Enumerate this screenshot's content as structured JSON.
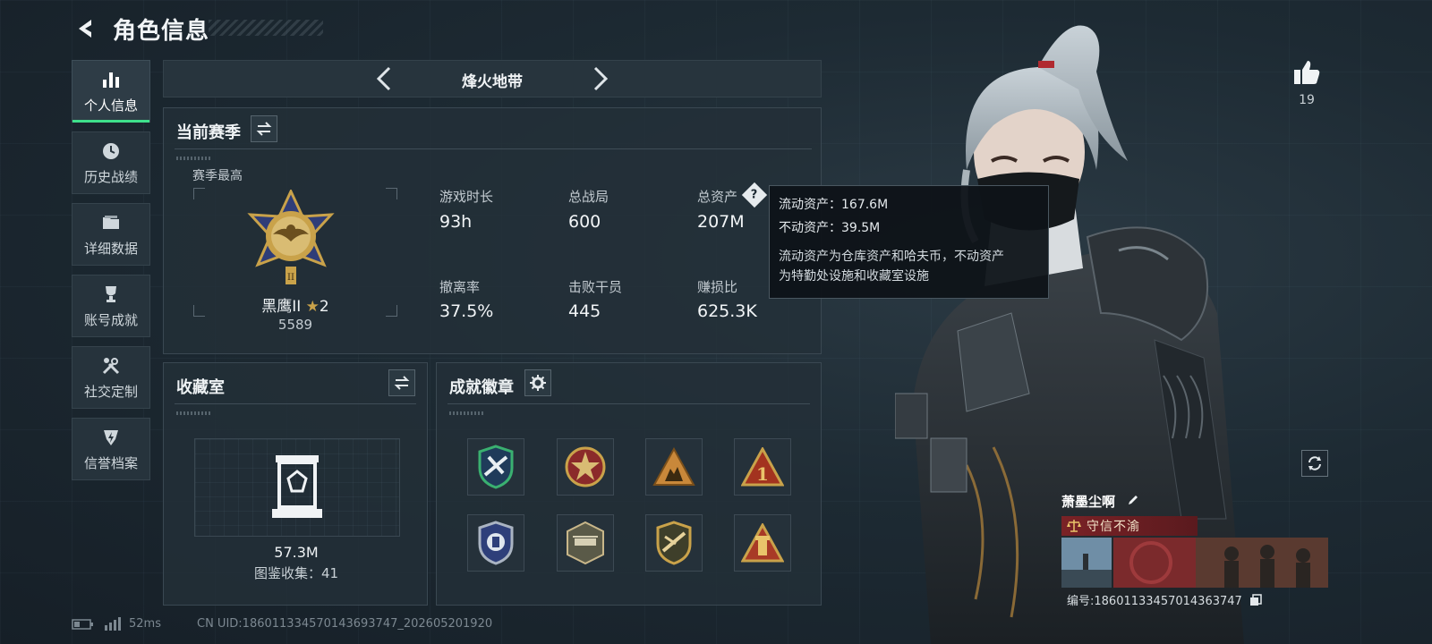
{
  "header": {
    "title": "角色信息"
  },
  "sidebar": {
    "items": [
      {
        "label": "个人信息",
        "icon": "bar-chart-icon",
        "active": true
      },
      {
        "label": "历史战绩",
        "icon": "clock-icon"
      },
      {
        "label": "详细数据",
        "icon": "folder-icon"
      },
      {
        "label": "账号成就",
        "icon": "trophy-icon"
      },
      {
        "label": "社交定制",
        "icon": "tools-icon"
      },
      {
        "label": "信誉档案",
        "icon": "shield-lightning-icon"
      }
    ]
  },
  "mode_selector": {
    "current": "烽火地带"
  },
  "season": {
    "title": "当前赛季",
    "best_label": "赛季最高",
    "rank_name": "黑鹰II",
    "rank_stars": "2",
    "rank_score": "5589",
    "stats": [
      {
        "label": "游戏时长",
        "value": "93h"
      },
      {
        "label": "总战局",
        "value": "600"
      },
      {
        "label": "总资产",
        "value": "207M"
      },
      {
        "label": "撤离率",
        "value": "37.5%"
      },
      {
        "label": "击败干员",
        "value": "445"
      },
      {
        "label": "赚损比",
        "value": "625.3K"
      }
    ]
  },
  "tooltip": {
    "liquid": "流动资产：167.6M",
    "fixed": "不动资产：39.5M",
    "description_line1": "流动资产为仓库资产和哈夫币，不动资产",
    "description_line2": "为特勤处设施和收藏室设施"
  },
  "collection": {
    "title": "收藏室",
    "value": "57.3M",
    "catalog": "图鉴收集：41"
  },
  "achievements": {
    "title": "成就徽章",
    "badges": [
      "badge-1",
      "badge-2",
      "badge-3",
      "badge-4",
      "badge-5",
      "badge-6",
      "badge-7",
      "badge-8"
    ]
  },
  "likes": {
    "count": "19"
  },
  "player": {
    "name": "萧墨尘啊",
    "title": "守信不渝",
    "id": "编号:18601133457014363747"
  },
  "status_bar": {
    "ping": "52ms",
    "uid": "CN UID:18601133457014369374​7_202605201920"
  },
  "colors": {
    "accent": "#3ee08c",
    "title_red": "#7a2226",
    "gold": "#c9a24a"
  }
}
